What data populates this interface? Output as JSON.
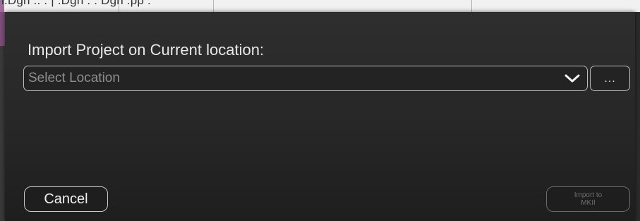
{
  "background_app": {
    "strip_text": "l.Dgn  ..  .   |  .Dgn  .  . Dgn    .pp ."
  },
  "dialog": {
    "title": "Import Project on Current location:",
    "location_select": {
      "placeholder": "Select Location",
      "icon": "chevron-down-icon"
    },
    "browse_button": {
      "label": "..."
    },
    "cancel_button": {
      "label": "Cancel"
    },
    "import_button": {
      "label_line1": "Import to",
      "label_line2": "MKII",
      "state": "disabled"
    }
  },
  "colors": {
    "dialog_background": "#2a2a2a",
    "border": "#bdbdbd",
    "title_text": "#e8e8e8",
    "placeholder_text": "#8e8e8e",
    "disabled_text": "#6e6e6e",
    "accent_pink": "#a06b96"
  }
}
